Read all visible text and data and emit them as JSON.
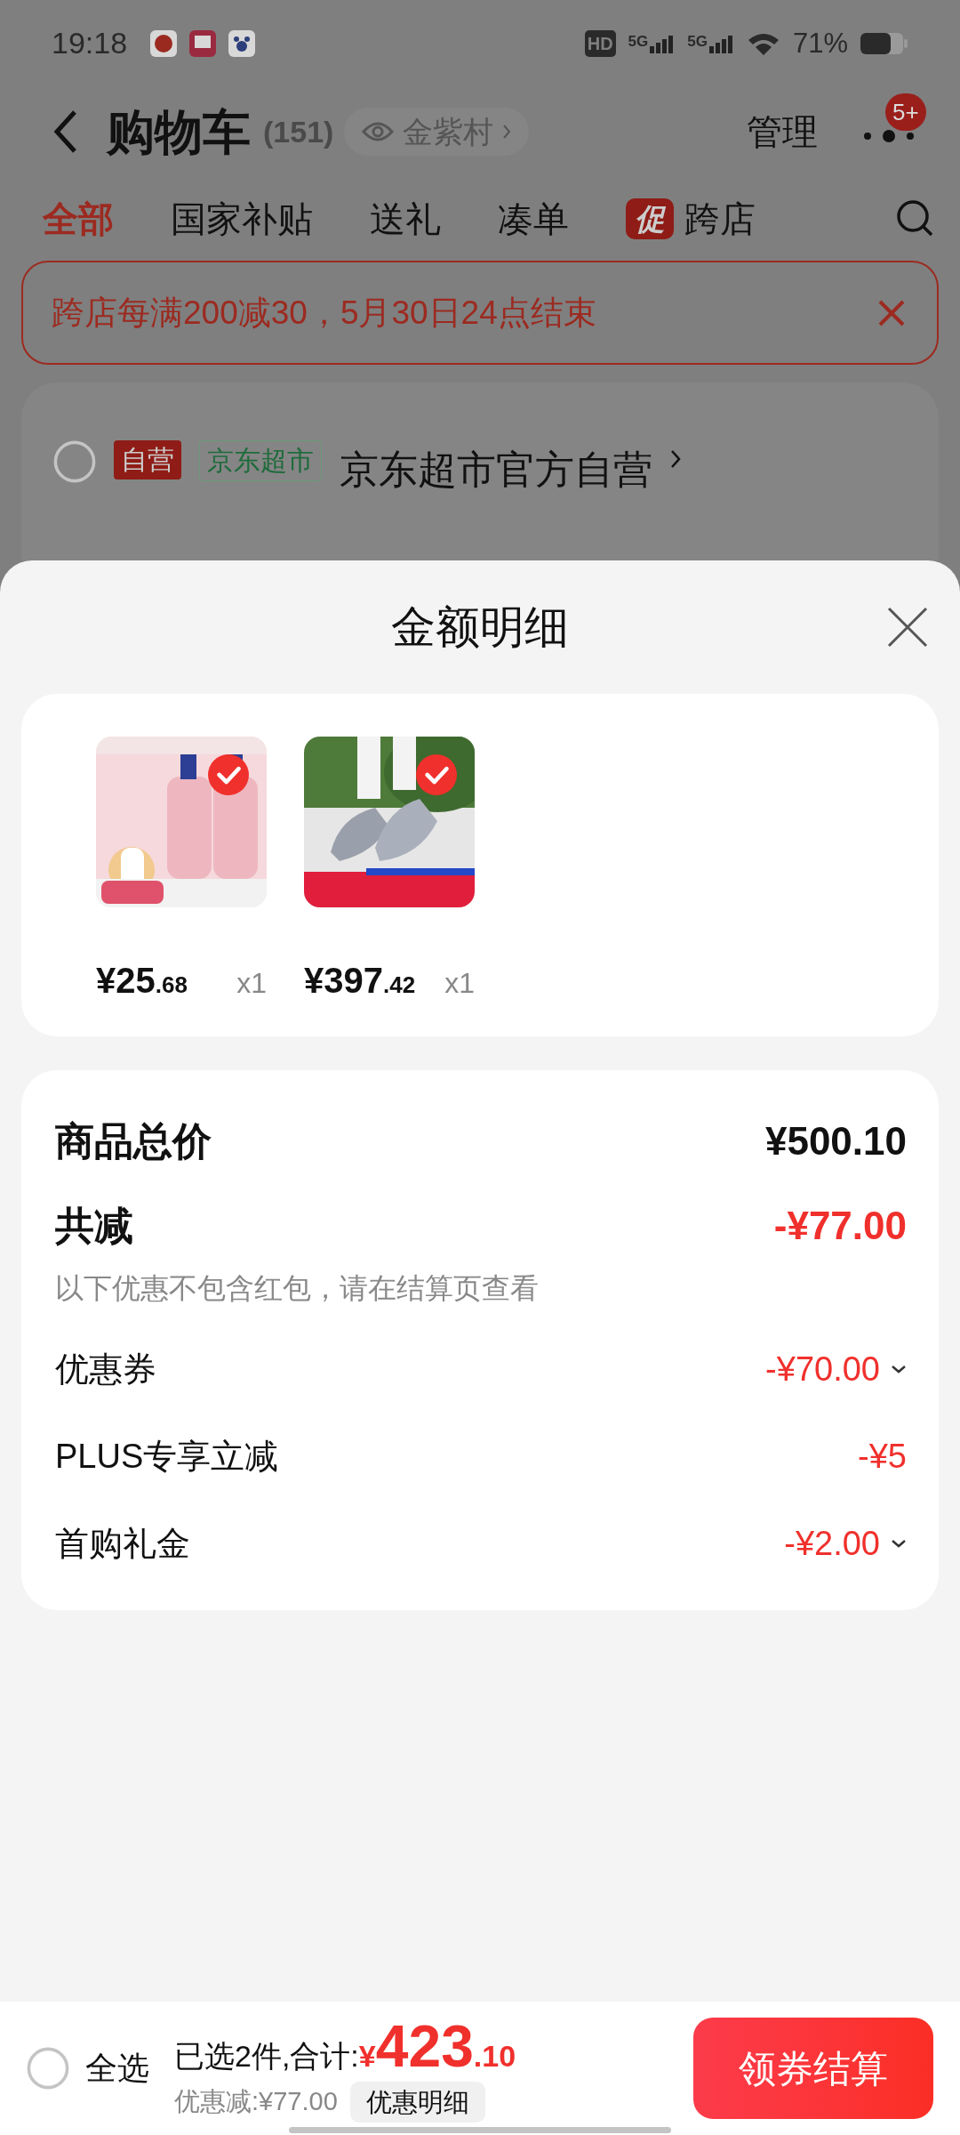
{
  "status_bar": {
    "time": "19:18",
    "indicators": [
      "HD",
      "5G",
      "5G"
    ],
    "battery": "71%"
  },
  "header": {
    "title": "购物车",
    "count": "(151)",
    "location": "金紫村",
    "manage": "管理",
    "more_badge": "5+"
  },
  "tabs": [
    {
      "label": "全部",
      "selected": true
    },
    {
      "label": "国家补贴",
      "selected": false
    },
    {
      "label": "送礼",
      "selected": false
    },
    {
      "label": "凑单",
      "selected": false
    },
    {
      "label": "跨店",
      "badge": "促",
      "selected": false
    }
  ],
  "promo_banner": {
    "text": "跨店每满200减30，5月30日24点结束"
  },
  "store": {
    "checked": false,
    "tags": [
      {
        "label": "自营",
        "kind": "solid"
      },
      {
        "label": "京东超市",
        "kind": "outline"
      }
    ],
    "name": "京东超市官方自营"
  },
  "sheet": {
    "title": "金额明细",
    "products": [
      {
        "kind": "bottles",
        "selected": true,
        "price_int": "¥25",
        "price_dec": ".68",
        "quantity": "x1"
      },
      {
        "kind": "shoes",
        "selected": true,
        "price_int": "¥397",
        "price_dec": ".42",
        "quantity": "x1"
      }
    ],
    "summary": [
      {
        "kind": "total",
        "label": "商品总价",
        "value": "¥500.10"
      },
      {
        "kind": "discount_total",
        "label": "共减",
        "value": "-¥77.00",
        "note": "以下优惠不包含红包，请在结算页查看"
      },
      {
        "kind": "item",
        "label": "优惠券",
        "value": "-¥70.00",
        "expandable": true
      },
      {
        "kind": "item",
        "label": "PLUS专享立减",
        "value": "-¥5",
        "expandable": false
      },
      {
        "kind": "item",
        "label": "首购礼金",
        "value": "-¥2.00",
        "expandable": true
      }
    ]
  },
  "bottom_bar": {
    "select_all": {
      "label": "全选",
      "checked": false
    },
    "selected_label": "已选2件,合计:",
    "currency": "¥",
    "total_int": "423",
    "total_dec": ".10",
    "discount": "优惠减:¥77.00",
    "details_button": "优惠明细",
    "checkout_button": "领券结算"
  }
}
